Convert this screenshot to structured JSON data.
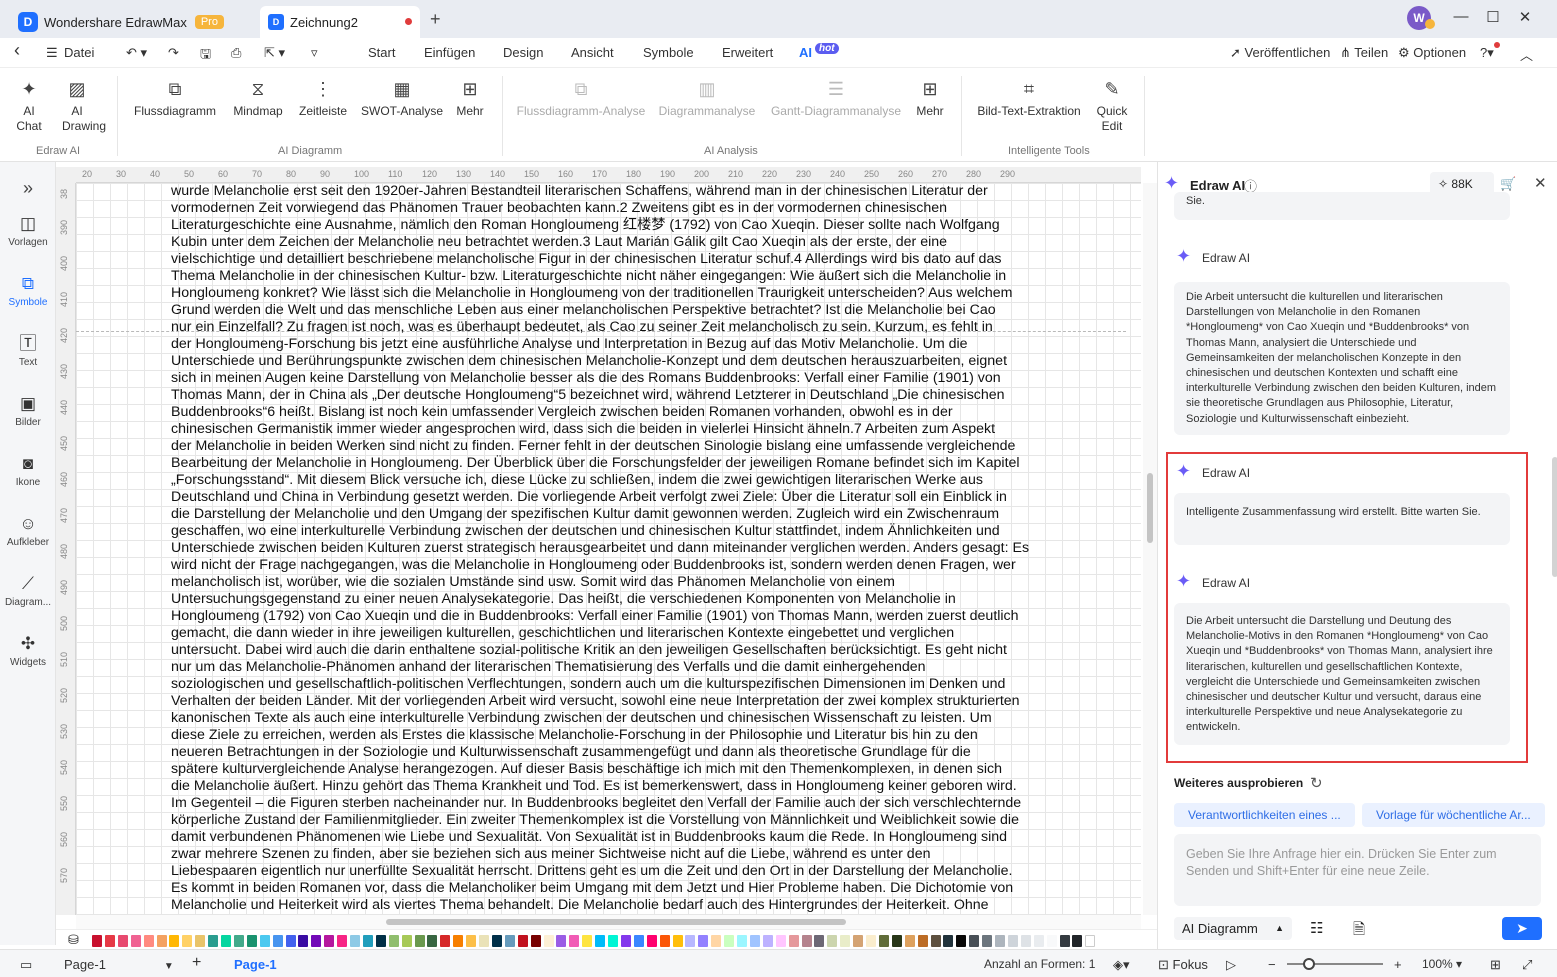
{
  "titlebar": {
    "app_name": "Wondershare EdrawMax",
    "pro_badge": "Pro",
    "doc_tab": "Zeichnung2",
    "add_tab": "+",
    "avatar_letter": "W",
    "minimize": "—",
    "maximize": "☐",
    "close": "✕"
  },
  "menubar": {
    "back": "‹",
    "file": "Datei",
    "items": [
      "Start",
      "Einfügen",
      "Design",
      "Ansicht",
      "Symbole",
      "Erweitert",
      "AI"
    ],
    "hot_badge": "hot",
    "publish": "Veröffentlichen",
    "share": "Teilen",
    "options": "Optionen",
    "help": "?"
  },
  "ribbon": {
    "ai_chat": [
      "AI",
      "Chat"
    ],
    "ai_drawing": [
      "AI",
      "Drawing"
    ],
    "flowchart": "Flussdiagramm",
    "mindmap": "Mindmap",
    "timeline": "Zeitleiste",
    "swot": "SWOT-Analyse",
    "more1": "Mehr",
    "flow_analysis": "Flussdiagramm-Analyse",
    "diagram_analysis": "Diagrammanalyse",
    "gantt_analysis": "Gantt-Diagrammanalyse",
    "more2": "Mehr",
    "ocr": "Bild-Text-Extraktion",
    "quick_edit": [
      "Quick",
      "Edit"
    ],
    "group_edraw_ai": "Edraw AI",
    "group_ai_diagram": "AI Diagramm",
    "group_ai_analysis": "AI Analysis",
    "group_tools": "Intelligente Tools"
  },
  "leftbar": {
    "collapse": "»",
    "items": [
      "Vorlagen",
      "Symbole",
      "Text",
      "Bilder",
      "Ikone",
      "Aufkleber",
      "Diagram...",
      "Widgets"
    ]
  },
  "rulers": {
    "top": [
      "20",
      "30",
      "40",
      "50",
      "60",
      "70",
      "80",
      "90",
      "100",
      "110",
      "120",
      "130",
      "140",
      "150",
      "160",
      "170",
      "180",
      "190",
      "200",
      "210",
      "220",
      "230",
      "240",
      "250",
      "260",
      "270",
      "280",
      "290"
    ],
    "left": [
      "38",
      "390",
      "400",
      "410",
      "420",
      "430",
      "440",
      "450",
      "460",
      "470",
      "480",
      "490",
      "500",
      "510",
      "520",
      "530",
      "540",
      "550",
      "560",
      "570"
    ]
  },
  "document": {
    "lines": [
      "wurde Melancholie erst seit den 1920er-Jahren Bestandteil literarischen Schaffens, während man in der chinesischen Literatur der",
      "vormodernen Zeit vorwiegend das Phänomen Trauer beobachten kann.2 Zweitens gibt es in der vormodernen chinesischen",
      "Literaturgeschichte eine Ausnahme, nämlich den Roman Hongloumeng 红楼梦 (1792) von Cao Xueqin. Dieser sollte nach Wolfgang",
      "Kubin unter dem Zeichen der Melancholie neu betrachtet werden.3 Laut Marián Gálik gilt Cao Xueqin als der erste, der eine",
      "vielschichtige und detailliert beschriebene melancholische Figur in der chinesischen Literatur schuf.4 Allerdings wird bis dato auf das",
      "Thema Melancholie in der chinesischen Kultur- bzw. Literaturgeschichte nicht näher eingegangen: Wie äußert sich die Melancholie in",
      "Hongloumeng konkret? Wie lässt sich die Melancholie in Hongloumeng von der traditionellen Traurigkeit unterscheiden? Aus welchem",
      "Grund werden die Welt und das menschliche Leben aus einer melancholischen Perspektive betrachtet? Ist die Melancholie bei Cao",
      "nur ein Einzelfall? Zu fragen ist noch, was es überhaupt bedeutet, als Cao zu seiner Zeit melancholisch zu sein. Kurzum, es fehlt in",
      "der Hongloumeng-Forschung bis jetzt eine ausführliche Analyse und Interpretation in Bezug auf das Motiv Melancholie.  Um die",
      "Unterschiede und Berührungspunkte zwischen dem chinesischen Melancholie-Konzept und dem deutschen herauszuarbeiten, eignet",
      "sich in meinen Augen keine Darstellung von Melancholie besser als die des Romans Buddenbrooks: Verfall einer Familie (1901) von",
      "Thomas Mann, der in China als „Der deutsche Hongloumeng“5 bezeichnet wird, während Letzterer in Deutschland „Die chinesischen",
      "Buddenbrooks“6 heißt. Bislang ist noch kein umfassender Vergleich zwischen beiden Romanen vorhanden, obwohl es in der",
      "chinesischen Germanistik immer wieder angesprochen wird, dass sich die beiden in vielerlei Hinsicht ähneln.7 Arbeiten zum Aspekt",
      "der Melancholie in beiden Werken sind nicht zu finden. Ferner fehlt in der deutschen Sinologie bislang eine umfassende vergleichende",
      "Bearbeitung der Melancholie in Hongloumeng. Der Überblick über die Forschungsfelder der jeweiligen Romane befindet sich im Kapitel",
      "„Forschungsstand“. Mit diesem Blick versuche ich, diese Lücke zu schließen, indem die zwei gewichtigen literarischen Werke aus",
      "Deutschland und China in Verbindung gesetzt werden. Die vorliegende Arbeit verfolgt zwei Ziele: Über die Literatur soll ein Einblick in",
      "die Darstellung der Melancholie und den Umgang der spezifischen Kultur damit gewonnen werden. Zugleich wird ein Zwischenraum",
      "geschaffen, wo eine interkulturelle Verbindung zwischen der deutschen und chinesischen Kultur stattfindet, indem Ähnlichkeiten und",
      "Unterschiede zwischen beiden Kulturen zuerst strategisch herausgearbeitet und dann miteinander verglichen werden. Anders gesagt: Es",
      "wird nicht der Frage nachgegangen, was die Melancholie in Hongloumeng oder Buddenbrooks ist, sondern werden denen Fragen, wer",
      "melancholisch ist, worüber, wie die sozialen Umstände sind usw. Somit wird das Phänomen Melancholie von einem",
      "Untersuchungsgegenstand zu einer neuen Analysekategorie. Das heißt, die verschiedenen Komponenten von Melancholie in",
      "Hongloumeng (1792) von Cao Xueqin und die in Buddenbrooks: Verfall einer Familie (1901) von Thomas Mann, werden zuerst deutlich",
      "gemacht, die dann wieder in ihre jeweiligen kulturellen, geschichtlichen und literarischen Kontexte eingebettet und verglichen",
      "untersucht. Dabei wird auch die darin enthaltene sozial-politische Kritik an den jeweiligen Gesellschaften berücksichtigt. Es geht nicht",
      "nur um das Melancholie-Phänomen anhand der literarischen Thematisierung des Verfalls und die damit einhergehenden",
      "soziologischen und gesellschaftlich-politischen Verflechtungen, sondern auch um die kulturspezifischen Dimensionen im Denken und",
      "Verhalten der beiden Länder. Mit der vorliegenden Arbeit wird versucht, sowohl eine neue Interpretation der zwei komplex strukturierten",
      "kanonischen Texte als auch eine interkulturelle Verbindung zwischen der deutschen und chinesischen Wissenschaft zu leisten. Um",
      "diese Ziele zu erreichen, werden als Erstes die klassische Melancholie-Forschung in der Philosophie und Literatur bis hin zu den",
      "neueren Betrachtungen in der Soziologie und Kulturwissenschaft zusammengefügt und dann als theoretische Grundlage für die",
      "spätere kulturvergleichende Analyse herangezogen. Auf dieser Basis beschäftige ich mich mit den Themenkomplexen, in denen sich",
      "die Melancholie äußert. Hinzu gehört das Thema Krankheit und Tod. Es ist bemerkenswert, dass in Hongloumeng keiner geboren wird.",
      "Im Gegenteil – die Figuren sterben nacheinander nur. In Buddenbrooks begleitet den Verfall der Familie auch der sich verschlechternde",
      "körperliche Zustand der Familienmitglieder. Ein zweiter Themenkomplex ist die Vorstellung von Männlichkeit und Weiblichkeit sowie die",
      "damit verbundenen Phänomenen wie Liebe und Sexualität. Von Sexualität ist in Buddenbrooks kaum die Rede. In Hongloumeng sind",
      "zwar mehrere Szenen zu finden, aber sie beziehen sich aus meiner Sichtweise nicht auf die Liebe, während es unter den",
      "Liebespaaren eigentlich nur unerfüllte Sexualität herrscht. Drittens geht es um die Zeit und den Ort in der Darstellung der Melancholie.",
      "Es kommt in beiden Romanen vor, dass die Melancholiker beim Umgang mit dem Jetzt und Hier Probleme haben. Die Dichotomie von",
      "Melancholie und Heiterkeit wird als viertes Thema behandelt. Die Melancholie bedarf auch des Hintergrundes der Heiterkeit. Ohne"
    ]
  },
  "statusbar": {
    "page_select": "Page-1",
    "add_page": "+",
    "active_page": "Page-1",
    "shape_count": "Anzahl an Formen: 1",
    "focus": "Fokus",
    "zoom": "100%"
  },
  "panel": {
    "title": "Edraw AI",
    "tokens": "88K",
    "clipped_text": "Sie.",
    "messages": [
      {
        "name": "Edraw AI",
        "text": "Die Arbeit untersucht die kulturellen und literarischen Darstellungen von Melancholie in den Romanen *Hongloumeng* von Cao Xueqin und *Buddenbrooks* von Thomas Mann, analysiert die Unterschiede und Gemeinsamkeiten der melancholischen Konzepte in den chinesischen und deutschen Kontexten und schafft eine interkulturelle Verbindung zwischen den beiden Kulturen, indem sie theoretische Grundlagen aus Philosophie, Literatur, Soziologie und Kulturwissenschaft einbezieht."
      },
      {
        "name": "Edraw AI",
        "text": "Intelligente Zusammenfassung wird erstellt. Bitte warten Sie."
      },
      {
        "name": "Edraw AI",
        "text": "Die Arbeit untersucht die Darstellung und Deutung des Melancholie-Motivs in den Romanen *Hongloumeng* von Cao Xueqin und *Buddenbrooks* von Thomas Mann, analysiert ihre literarischen, kulturellen und gesellschaftlichen Kontexte, vergleicht die Unterschiede und Gemeinsamkeiten zwischen chinesischer und deutscher Kultur und versucht, daraus eine interkulturelle Perspektive und neue Analysekategorie zu entwickeln."
      }
    ],
    "try_more": "Weiteres ausprobieren",
    "chips": [
      "Verantwortlichkeiten eines ...",
      "Vorlage für wöchentliche Ar..."
    ],
    "input_placeholder": "Geben Sie Ihre Anfrage hier ein. Drücken Sie Enter zum Senden und Shift+Enter für eine neue Zeile.",
    "mode_select": "AI Diagramm"
  },
  "colors": {
    "accent": "#1f6fff",
    "highlight_border": "#e23b3b",
    "ai_star": "#6a5cf6",
    "palette": [
      "#c8102e",
      "#e63946",
      "#e84a6f",
      "#f06292",
      "#ff8a80",
      "#f4a261",
      "#ffb703",
      "#ffd166",
      "#e9c46a",
      "#2a9d8f",
      "#06d6a0",
      "#43aa8b",
      "#1a936f",
      "#4cc9f0",
      "#4895ef",
      "#4361ee",
      "#3a0ca3",
      "#7209b7",
      "#b5179e",
      "#f72585",
      "#8ecae6",
      "#219ebc",
      "#023047",
      "#90be6d",
      "#a7c957",
      "#6a994e",
      "#386641",
      "#d62828",
      "#f77f00",
      "#fcbf49",
      "#eae2b7",
      "#003049",
      "#669bbc",
      "#c1121f",
      "#780000",
      "#fdf0d5",
      "#9b5de5",
      "#f15bb5",
      "#fee440",
      "#00bbf9",
      "#00f5d4",
      "#8338ec",
      "#3a86ff",
      "#ff006e",
      "#fb5607",
      "#ffbe0b",
      "#b8b8ff",
      "#9381ff",
      "#ffd6a5",
      "#caffbf",
      "#9bf6ff",
      "#a0c4ff",
      "#bdb2ff",
      "#ffc6ff",
      "#e5989b",
      "#b5838d",
      "#6d6875",
      "#ccd5ae",
      "#e9edc9",
      "#d4a373",
      "#faedcd",
      "#606c38",
      "#283618",
      "#dda15e",
      "#bc6c25",
      "#5e503f",
      "#22333b",
      "#0a0908",
      "#495057",
      "#6c757d",
      "#adb5bd",
      "#ced4da",
      "#dee2e6",
      "#e9ecef",
      "#f8f9fa",
      "#343a40",
      "#212529",
      "#ffffff"
    ]
  }
}
